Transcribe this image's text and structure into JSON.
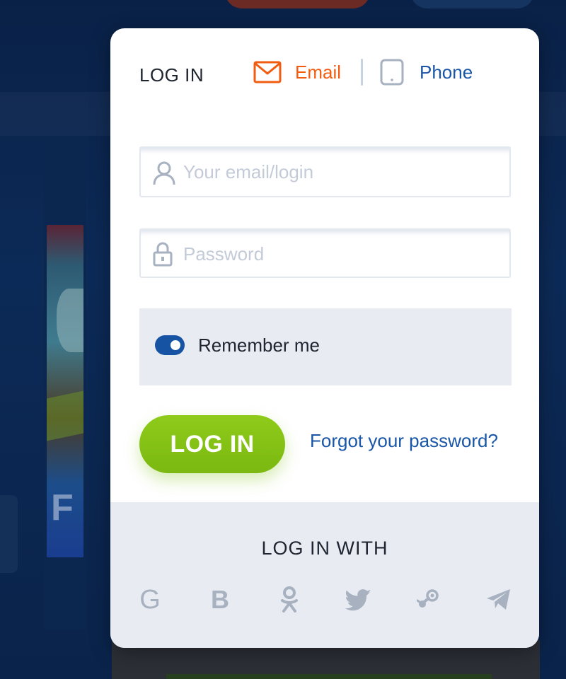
{
  "modal": {
    "title": "LOG IN",
    "tabs": [
      {
        "label": "Email",
        "icon": "envelope-icon",
        "active": true,
        "color": "#f25c10"
      },
      {
        "label": "Phone",
        "icon": "mobile-phone-icon",
        "active": false,
        "color": "#1a56a8"
      }
    ],
    "email_field": {
      "placeholder": "Your email/login",
      "value": "",
      "icon": "user-icon"
    },
    "password_field": {
      "placeholder": "Password",
      "value": "",
      "icon": "padlock-icon"
    },
    "remember": {
      "label": "Remember me",
      "enabled": true
    },
    "login_button": "LOG IN",
    "forgot_link": "Forgot your password?",
    "social": {
      "title": "LOG IN WITH",
      "providers": [
        {
          "name": "google",
          "glyph": "G"
        },
        {
          "name": "b",
          "glyph": "B"
        },
        {
          "name": "odnoklassniki",
          "glyph": ""
        },
        {
          "name": "twitter",
          "glyph": ""
        },
        {
          "name": "steam",
          "glyph": ""
        },
        {
          "name": "telegram",
          "glyph": ""
        }
      ]
    }
  },
  "colors": {
    "accent_orange": "#f25c10",
    "link_blue": "#1a56a8",
    "button_green": "#84c216",
    "background_navy": "#0c2a57"
  }
}
